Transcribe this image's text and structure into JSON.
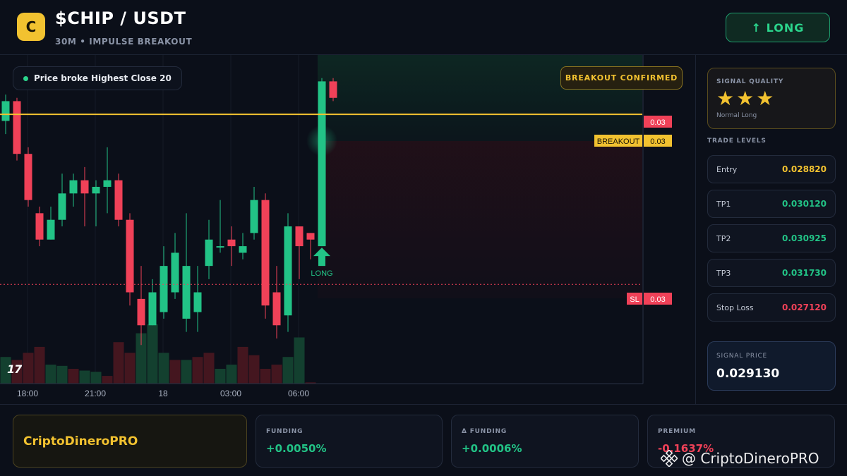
{
  "header": {
    "logo_letter": "C",
    "title": "$CHIP / USDT",
    "subtitle": "30M • IMPULSE BREAKOUT",
    "long_button": "↑ LONG"
  },
  "chart": {
    "price_chip": "Price broke Highest Close 20",
    "breakout_chip": "BREAKOUT CONFIRMED",
    "signal_arrow_label": "LONG",
    "tag_current": "0.03",
    "tag_breakout_label": "BREAKOUT",
    "tag_breakout_value": "0.03",
    "tag_sl_label": "SL",
    "tag_sl_value": "0.03",
    "time_labels": [
      "18:00",
      "21:00",
      "18",
      "03:00",
      "06:00"
    ],
    "tv_logo": "17",
    "colors": {
      "up": "#22c386",
      "down": "#f04158",
      "breakout": "#f2c230"
    }
  },
  "chart_data": {
    "type": "candlestick",
    "x": [
      "t1",
      "t2",
      "t3",
      "t4",
      "t5",
      "t6",
      "t7",
      "t8",
      "t9",
      "t10",
      "t11",
      "t12",
      "t13",
      "t14",
      "t15",
      "t16",
      "t17",
      "t18",
      "t19",
      "t20",
      "t21",
      "t22",
      "t23",
      "t24",
      "t25",
      "t26",
      "t27",
      "t28"
    ],
    "open": [
      0.0296,
      0.0299,
      0.0291,
      0.0282,
      0.0278,
      0.0281,
      0.0285,
      0.0287,
      0.0285,
      0.0286,
      0.0287,
      0.0281,
      0.0269,
      0.0265,
      0.0267,
      0.027,
      0.0266,
      0.0267,
      0.0274,
      0.0277,
      0.0278,
      0.0276,
      0.0279,
      0.0284,
      0.027,
      0.02665,
      0.028,
      0.0279
    ],
    "close": [
      0.0299,
      0.0291,
      0.0284,
      0.0278,
      0.0281,
      0.0285,
      0.0287,
      0.0285,
      0.0286,
      0.0287,
      0.0281,
      0.027,
      0.0265,
      0.027,
      0.0274,
      0.0276,
      0.0274,
      0.027,
      0.0278,
      0.0277,
      0.0277,
      0.0277,
      0.0284,
      0.0268,
      0.0265,
      0.028,
      0.0277,
      0.0278
    ],
    "high": [
      0.03,
      0.02995,
      0.0292,
      0.0283,
      0.0283,
      0.0288,
      0.0288,
      0.0289,
      0.0287,
      0.0292,
      0.0288,
      0.0282,
      0.0274,
      0.0272,
      0.0277,
      0.0279,
      0.0282,
      0.0274,
      0.0281,
      0.0284,
      0.028,
      0.0279,
      0.0286,
      0.0285,
      0.0274,
      0.0282,
      0.028,
      0.0279
    ],
    "low": [
      0.0294,
      0.029,
      0.0283,
      0.0277,
      0.0278,
      0.028,
      0.0283,
      0.028,
      0.028,
      0.0282,
      0.028,
      0.0268,
      0.0262,
      0.0265,
      0.0266,
      0.0269,
      0.0264,
      0.0264,
      0.0272,
      0.0276,
      0.0274,
      0.0275,
      0.0278,
      0.0266,
      0.0263,
      0.0264,
      0.0272,
      0.0275
    ],
    "signal_candle": {
      "open": 0.0277,
      "close": 0.0302,
      "high": 0.03025,
      "low": 0.0277
    },
    "last_candle": {
      "open": 0.0302,
      "close": 0.02995,
      "high": 0.03025,
      "low": 0.0299
    },
    "breakout_level": 0.0297,
    "stop_loss_level": 0.02712,
    "ylim": [
      0.026,
      0.0306
    ]
  },
  "volume_data": {
    "values": [
      45,
      40,
      52,
      62,
      32,
      30,
      25,
      22,
      20,
      13,
      70,
      52,
      85,
      100,
      52,
      40,
      40,
      45,
      52,
      25,
      32,
      62,
      48,
      25,
      32,
      45,
      78,
      2
    ],
    "up": [
      true,
      false,
      false,
      false,
      true,
      true,
      false,
      true,
      true,
      false,
      false,
      false,
      true,
      true,
      true,
      false,
      true,
      false,
      false,
      true,
      true,
      false,
      false,
      false,
      false,
      true,
      true,
      false
    ]
  },
  "side": {
    "quality_title": "SIGNAL QUALITY",
    "stars": "★★★",
    "quality_sub": "Normal Long",
    "levels_title": "TRADE LEVELS",
    "levels": [
      {
        "name": "Entry",
        "value": "0.028820",
        "color": "#f2c230"
      },
      {
        "name": "TP1",
        "value": "0.030120",
        "color": "#22c386"
      },
      {
        "name": "TP2",
        "value": "0.030925",
        "color": "#22c386"
      },
      {
        "name": "TP3",
        "value": "0.031730",
        "color": "#22c386"
      },
      {
        "name": "Stop Loss",
        "value": "0.027120",
        "color": "#f04158"
      }
    ],
    "signal_price_title": "SIGNAL PRICE",
    "signal_price": "0.029130"
  },
  "bottom": {
    "brand": "CriptoDineroPRO",
    "stats": [
      {
        "title": "FUNDING",
        "value": "+0.0050%",
        "color": "#22c386"
      },
      {
        "title": "Δ FUNDING",
        "value": "+0.0006%",
        "color": "#22c386"
      },
      {
        "title": "PREMIUM",
        "value": "-0.1637%",
        "color": "#f04158"
      }
    ],
    "watermark": "@ CriptoDineroPRO"
  }
}
